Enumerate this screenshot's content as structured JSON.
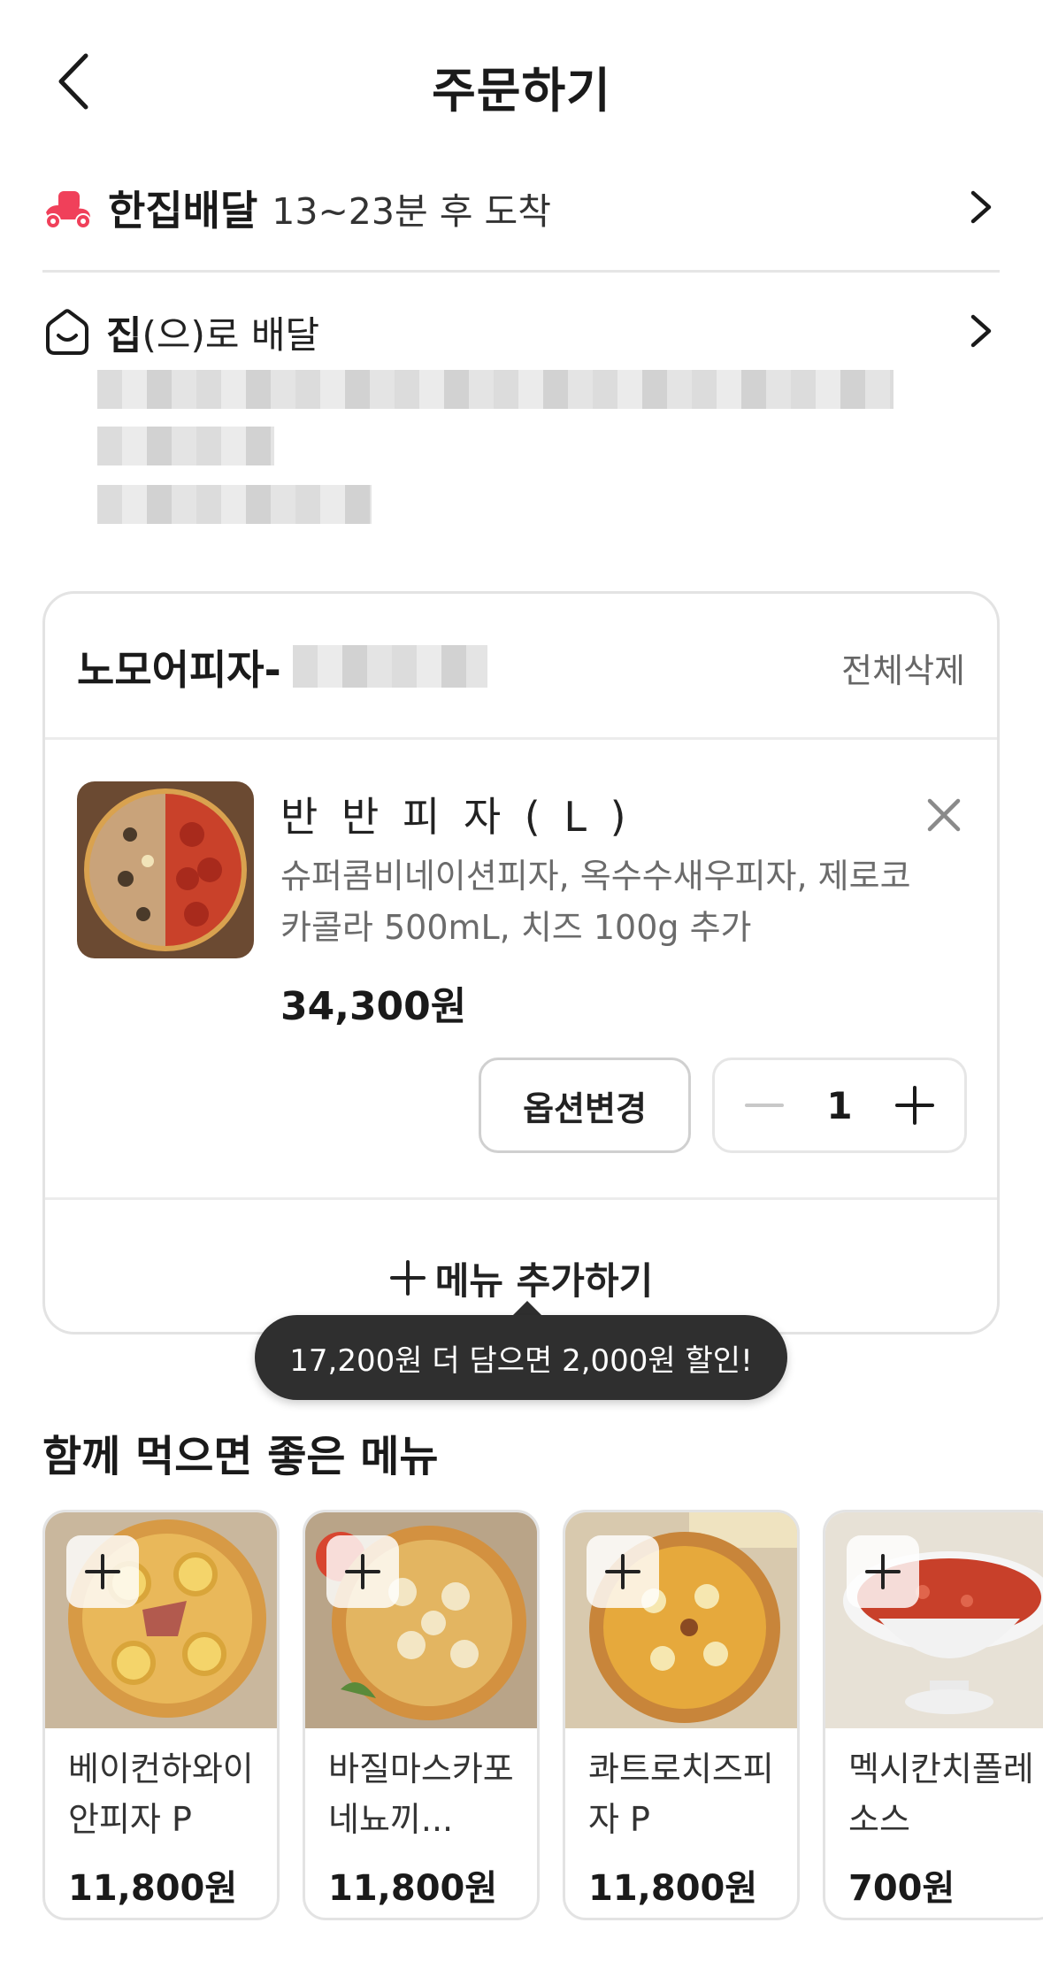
{
  "header": {
    "title": "주문하기"
  },
  "delivery": {
    "type": "한집배달",
    "eta": "13~23분 후 도착"
  },
  "address": {
    "name": "집",
    "suffix": "(으)로 배달"
  },
  "cart": {
    "store_name": "노모어피자-",
    "delete_all": "전체삭제",
    "item": {
      "name": "반 반 피 자 ( L )",
      "options": "슈퍼콤비네이션피자, 옥수수새우피자, 제로코카콜라 500mL, 치즈 100g 추가",
      "price": "34,300원",
      "option_change": "옵션변경",
      "quantity": "1"
    },
    "add_menu": "메뉴 추가하기"
  },
  "tooltip": "17,200원 더 담으면 2,000원 할인!",
  "recommend": {
    "title": "함께 먹으면 좋은 메뉴",
    "items": [
      {
        "name": "베이컨하와이안피자 P",
        "price": "11,800원"
      },
      {
        "name": "바질마스카포네뇨끼...",
        "price": "11,800원"
      },
      {
        "name": "콰트로치즈피자 P",
        "price": "11,800원"
      },
      {
        "name": "멕시칸치폴레소스",
        "price": "700원"
      }
    ]
  },
  "colors": {
    "accent_red": "#f0405a",
    "tooltip_bg": "#2f2f2f",
    "border": "#e3e3e3"
  }
}
